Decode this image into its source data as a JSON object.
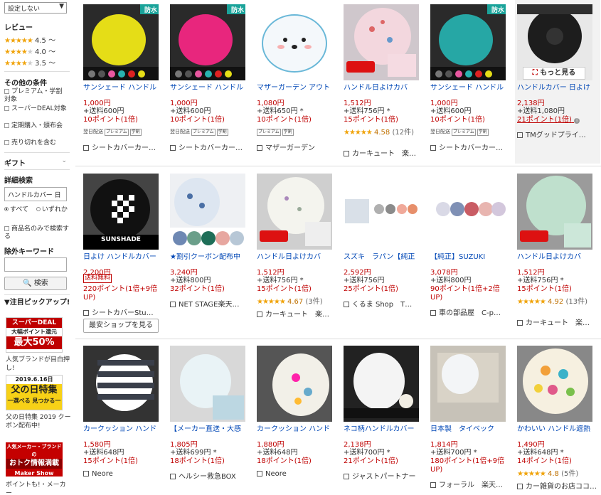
{
  "sidebar": {
    "sort_select": "設定しない",
    "review_heading": "レビュー",
    "ratings": [
      {
        "label": "4.5 〜",
        "stars": 4.5
      },
      {
        "label": "4.0 〜",
        "stars": 4
      },
      {
        "label": "3.5 〜",
        "stars": 3.5
      }
    ],
    "other_heading": "その他の条件",
    "conditions": [
      "プレミアム・学割 対象",
      "スーパーDEAL対象",
      "定期購入・頒布会",
      "売り切れを含む"
    ],
    "gift_heading": "ギフト",
    "detail_heading": "詳細検索",
    "keyword_value": "ハンドルカバー 日",
    "radio_all": "すべて",
    "radio_any": "いずれか",
    "title_only": "商品名のみで検索する",
    "exclude_heading": "除外キーワード",
    "exclude_value": "",
    "search_button": "検索",
    "pickup_heading": "▼注目ピックアップ!",
    "banner1": {
      "line1": "スーパーDEAL",
      "line2": "大幅ポイント還元",
      "line3": "最大50%",
      "accent": "#bf0000"
    },
    "banner1_text": "人気ブランドが目白押し!",
    "banner2": {
      "line1": "2019.6.16日",
      "line2": "父の日特集",
      "line3": "一選べる 見つかる一",
      "accent": "#f2c200"
    },
    "banner2_text": "父の日特集 2019 クーポン配布中!",
    "banner3": {
      "line1": "人気メーカー・ブランドの",
      "line2": "おトク情報満載",
      "line3": "Maker Show Room",
      "accent": "#c40000"
    },
    "banner3_text": "ポイントも!・メーカー"
  },
  "products": [
    {
      "title": "サンシェード ハンドル",
      "price": "1,000円",
      "ship": "+送料600円",
      "points": "10ポイント(1倍)",
      "badges": [
        "翌日配送",
        "プレミアム",
        "学割"
      ],
      "shop": "シートカバーカー…",
      "img": "yellow",
      "tag": "防水"
    },
    {
      "title": "サンシェード ハンドル",
      "price": "1,000円",
      "ship": "+送料600円",
      "points": "10ポイント(1倍)",
      "badges": [
        "翌日配送",
        "プレミアム",
        "学割"
      ],
      "shop": "シートカバーカー…",
      "img": "pink",
      "tag": "防水"
    },
    {
      "title": "マザーガーデン アウト",
      "price": "1,080円",
      "ship": "+送料650円 *",
      "points": "10ポイント(1倍)",
      "badges": [
        "プレミアム",
        "学割"
      ],
      "shop": "マザーガーデン",
      "img": "seal"
    },
    {
      "title": "ハンドル日よけカバ",
      "price": "1,512円",
      "ship": "+送料756円 *",
      "points": "15ポイント(1倍)",
      "rating": "4.58",
      "reviews": "(12件)",
      "stars": 4.5,
      "shop": "カーキュート　楽…",
      "img": "floral-pink"
    },
    {
      "title": "サンシェード ハンドル",
      "price": "1,000円",
      "ship": "+送料600円",
      "points": "10ポイント(1倍)",
      "badges": [
        "翌日配送",
        "プレミアム",
        "学割"
      ],
      "shop": "シートカバーカー…",
      "img": "teal",
      "tag": "防水"
    },
    {
      "title": "ハンドルカバー 日よけ",
      "price": "2,138円",
      "ship": "+送料1,080円",
      "points": "21ポイント(1倍)",
      "shop": "TMグッドプライ…",
      "img": "black-wheel",
      "more": "もっと見る",
      "highlight": true
    },
    {
      "title": "日よけ ハンドルカバー",
      "price": "2,200円",
      "ship_free": "送料無料",
      "points": "220ポイント(1倍+9倍UP)",
      "shop": "シートカバーStu…",
      "img": "checker",
      "best": "最安ショップを見る",
      "caption": "SUNSHADE"
    },
    {
      "title": "★割引クーポン配布中",
      "price": "3,240円",
      "ship": "+送料800円",
      "points": "32ポイント(1倍)",
      "shop": "NET STAGE楽天…",
      "img": "multi-blue"
    },
    {
      "title": "ハンドル日よけカバ",
      "price": "1,512円",
      "ship": "+送料756円 *",
      "points": "15ポイント(1倍)",
      "rating": "4.67",
      "reviews": "(3件)",
      "stars": 4.5,
      "shop": "カーキュート　楽…",
      "img": "floral-white"
    },
    {
      "title": "スズキ　ラパン【純正",
      "price": "2,592円",
      "ship": "+送料756円",
      "points": "25ポイント(1倍)",
      "shop": "くるま Shop　T…",
      "img": "lapin"
    },
    {
      "title": "【純正】SUZUKI",
      "price": "3,078円",
      "ship": "+送料800円",
      "points": "90ポイント(1倍+2倍UP)",
      "shop": "車の部品屋　C-p…",
      "img": "suzuki"
    },
    {
      "title": "ハンドル日よけカバ",
      "price": "1,512円",
      "ship": "+送料756円 *",
      "points": "15ポイント(1倍)",
      "rating": "4.92",
      "reviews": "(13件)",
      "stars": 5,
      "shop": "カーキュート　楽…",
      "img": "dots"
    },
    {
      "title": "カークッション ハンド",
      "price": "1,580円",
      "ship": "+送料648円",
      "points": "15ポイント(1倍)",
      "shop": "Neore",
      "img": "stripes"
    },
    {
      "title": "【メーカー直送・大感",
      "price": "1,805円",
      "ship": "+送料699円 *",
      "points": "18ポイント(1倍)",
      "shop": "ヘルシー救急BOX",
      "img": "light-blue"
    },
    {
      "title": "カークッション ハンド",
      "price": "1,880円",
      "ship": "+送料648円",
      "points": "18ポイント(1倍)",
      "shop": "Neore",
      "img": "flowers"
    },
    {
      "title": "ネコ柄ハンドルカバー",
      "price": "2,138円",
      "ship": "+送料700円 *",
      "points": "21ポイント(1倍)",
      "shop": "ジャストパートナー",
      "img": "cat"
    },
    {
      "title": "日本製　タイベック",
      "price": "1,814円",
      "ship": "+送料700円 *",
      "points": "180ポイント(1倍+9倍UP)",
      "shop": "フォーラル　楽天…",
      "img": "tyvek"
    },
    {
      "title": "かわいい ハンドル遮熱",
      "price": "1,490円",
      "ship": "+送料648円 *",
      "points": "14ポイント(1倍)",
      "rating": "4.8",
      "reviews": "(5件)",
      "stars": 5,
      "shop": "カー雑貨のお店ココ…",
      "img": "colorful"
    }
  ]
}
